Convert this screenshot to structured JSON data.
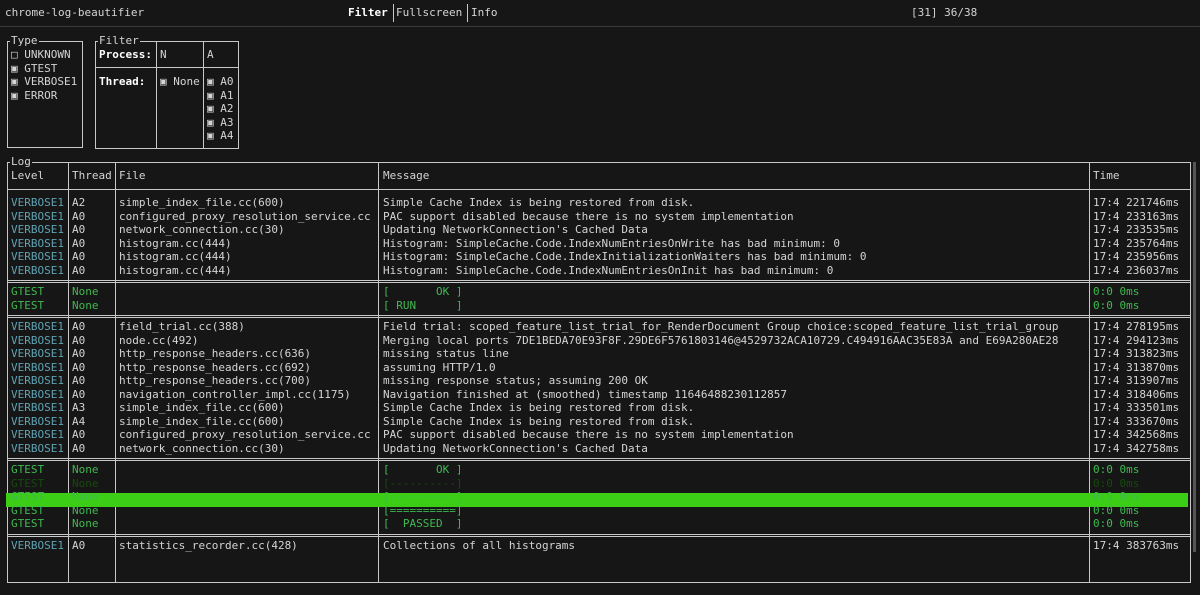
{
  "app": {
    "title": "chrome-log-beautifier",
    "tabs": [
      "Filter",
      "Fullscreen",
      "Info"
    ],
    "counter": "[31] 36/38"
  },
  "type_panel": {
    "legend": "Type",
    "items": [
      {
        "label": "UNKNOWN",
        "checked": false
      },
      {
        "label": "GTEST",
        "checked": true
      },
      {
        "label": "VERBOSE1",
        "checked": true
      },
      {
        "label": "ERROR",
        "checked": true
      }
    ]
  },
  "filter_panel": {
    "legend": "Filter",
    "process_label": "Process:",
    "process_value": "N",
    "process_value2": "A",
    "thread_label": "Thread:",
    "thread_none": "None",
    "threads": [
      "A0",
      "A1",
      "A2",
      "A3",
      "A4"
    ]
  },
  "log": {
    "legend": "Log",
    "headers": {
      "level": "Level",
      "thread": "Thread",
      "file": "File",
      "message": "Message",
      "time": "Time"
    },
    "groups": [
      {
        "rows": [
          {
            "level": "VERBOSE1",
            "thread": "A2",
            "file": "simple_index_file.cc(600)",
            "message": "Simple Cache Index is being restored from disk.",
            "time": "17:4 221746ms"
          },
          {
            "level": "VERBOSE1",
            "thread": "A0",
            "file": "configured_proxy_resolution_service.cc",
            "message": "PAC support disabled because there is no system implementation",
            "time": "17:4 233163ms"
          },
          {
            "level": "VERBOSE1",
            "thread": "A0",
            "file": "network_connection.cc(30)",
            "message": "Updating NetworkConnection's Cached Data",
            "time": "17:4 233535ms"
          },
          {
            "level": "VERBOSE1",
            "thread": "A0",
            "file": "histogram.cc(444)",
            "message": "Histogram: SimpleCache.Code.IndexNumEntriesOnWrite has bad minimum: 0",
            "time": "17:4 235764ms"
          },
          {
            "level": "VERBOSE1",
            "thread": "A0",
            "file": "histogram.cc(444)",
            "message": "Histogram: SimpleCache.Code.IndexInitializationWaiters has bad minimum: 0",
            "time": "17:4 235956ms"
          },
          {
            "level": "VERBOSE1",
            "thread": "A0",
            "file": "histogram.cc(444)",
            "message": "Histogram: SimpleCache.Code.IndexNumEntriesOnInit has bad minimum: 0",
            "time": "17:4 236037ms"
          }
        ]
      },
      {
        "rows": [
          {
            "level": "GTEST",
            "thread": "None",
            "file": "",
            "message": "[       OK ]",
            "time": "0:0 0ms"
          },
          {
            "level": "GTEST",
            "thread": "None",
            "file": "",
            "message": "[ RUN      ]",
            "time": "0:0 0ms"
          }
        ]
      },
      {
        "rows": [
          {
            "level": "VERBOSE1",
            "thread": "A0",
            "file": "field_trial.cc(388)",
            "message": "Field trial: scoped_feature_list_trial_for_RenderDocument Group choice:scoped_feature_list_trial_group",
            "time": "17:4 278195ms"
          },
          {
            "level": "VERBOSE1",
            "thread": "A0",
            "file": "node.cc(492)",
            "message": "Merging local ports 7DE1BEDA70E93F8F.29DE6F5761803146@4529732ACA10729.C494916AAC35E83A and E69A280AE28",
            "time": "17:4 294123ms"
          },
          {
            "level": "VERBOSE1",
            "thread": "A0",
            "file": "http_response_headers.cc(636)",
            "message": "missing status line",
            "time": "17:4 313823ms"
          },
          {
            "level": "VERBOSE1",
            "thread": "A0",
            "file": "http_response_headers.cc(692)",
            "message": "assuming HTTP/1.0",
            "time": "17:4 313870ms"
          },
          {
            "level": "VERBOSE1",
            "thread": "A0",
            "file": "http_response_headers.cc(700)",
            "message": "missing response status; assuming 200 OK",
            "time": "17:4 313907ms"
          },
          {
            "level": "VERBOSE1",
            "thread": "A0",
            "file": "navigation_controller_impl.cc(1175)",
            "message": "Navigation finished at (smoothed) timestamp 11646488230112857",
            "time": "17:4 318406ms"
          },
          {
            "level": "VERBOSE1",
            "thread": "A3",
            "file": "simple_index_file.cc(600)",
            "message": "Simple Cache Index is being restored from disk.",
            "time": "17:4 333501ms"
          },
          {
            "level": "VERBOSE1",
            "thread": "A4",
            "file": "simple_index_file.cc(600)",
            "message": "Simple Cache Index is being restored from disk.",
            "time": "17:4 333670ms"
          },
          {
            "level": "VERBOSE1",
            "thread": "A0",
            "file": "configured_proxy_resolution_service.cc",
            "message": "PAC support disabled because there is no system implementation",
            "time": "17:4 342568ms"
          },
          {
            "level": "VERBOSE1",
            "thread": "A0",
            "file": "network_connection.cc(30)",
            "message": "Updating NetworkConnection's Cached Data",
            "time": "17:4 342758ms"
          }
        ]
      },
      {
        "rows": [
          {
            "level": "GTEST",
            "thread": "None",
            "file": "",
            "message": "[       OK ]",
            "time": "0:0 0ms"
          },
          {
            "level": "GTEST",
            "thread": "None",
            "file": "",
            "message": "[----------]",
            "time": "0:0 0ms",
            "selected": true
          },
          {
            "level": "GTEST",
            "thread": "None",
            "file": "",
            "message": "[----------]",
            "time": "0:0 0ms"
          },
          {
            "level": "GTEST",
            "thread": "None",
            "file": "",
            "message": "[==========]",
            "time": "0:0 0ms"
          },
          {
            "level": "GTEST",
            "thread": "None",
            "file": "",
            "message": "[  PASSED  ]",
            "time": "0:0 0ms"
          }
        ]
      },
      {
        "rows": [
          {
            "level": "VERBOSE1",
            "thread": "A0",
            "file": "statistics_recorder.cc(428)",
            "message": "Collections of all histograms",
            "time": "17:4 383763ms"
          }
        ]
      }
    ]
  }
}
